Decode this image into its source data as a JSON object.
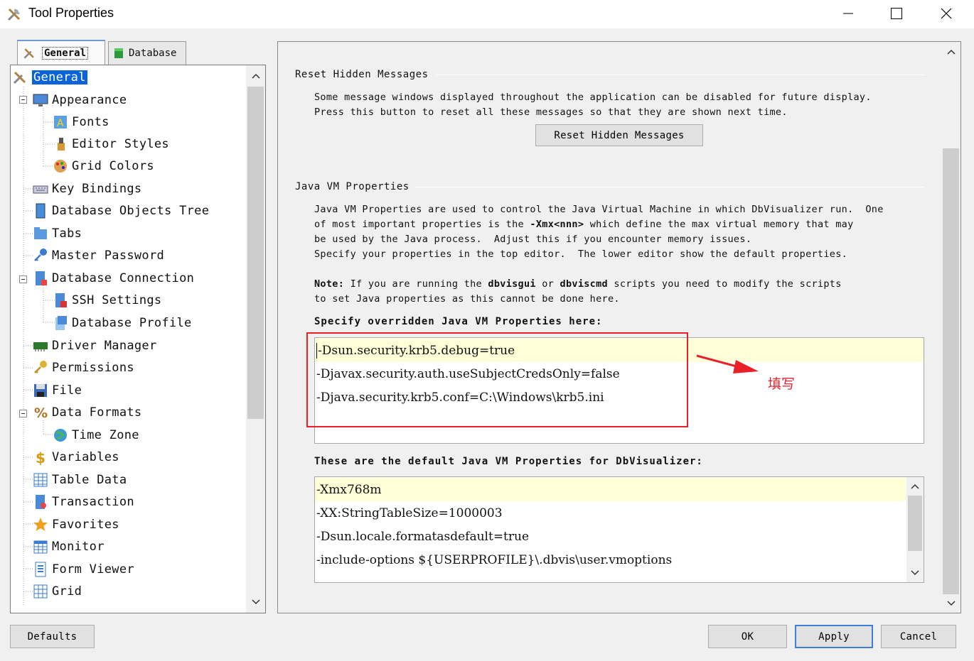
{
  "window": {
    "title": "Tool Properties",
    "app_icon": "tools-icon",
    "controls": [
      "minimize",
      "maximize",
      "close"
    ]
  },
  "tabs": [
    {
      "label": "General",
      "icon": "tools-icon",
      "active": true
    },
    {
      "label": "Database",
      "icon": "database-icon",
      "active": false
    }
  ],
  "tree": {
    "items": [
      {
        "label": "General",
        "icon": "tools-icon",
        "level": 0,
        "selected": true
      },
      {
        "label": "Appearance",
        "icon": "monitor-icon",
        "level": 1,
        "expanded": true
      },
      {
        "label": "Fonts",
        "icon": "font-icon",
        "level": 2
      },
      {
        "label": "Editor Styles",
        "icon": "brush-icon",
        "level": 2
      },
      {
        "label": "Grid Colors",
        "icon": "palette-icon",
        "level": 2
      },
      {
        "label": "Key Bindings",
        "icon": "keyboard-icon",
        "level": 1
      },
      {
        "label": "Database Objects Tree",
        "icon": "tree-panel-icon",
        "level": 1
      },
      {
        "label": "Tabs",
        "icon": "tabs-icon",
        "level": 1
      },
      {
        "label": "Master Password",
        "icon": "key-icon",
        "level": 1
      },
      {
        "label": "Database Connection",
        "icon": "db-connection-icon",
        "level": 1,
        "expanded": true
      },
      {
        "label": "SSH Settings",
        "icon": "ssh-icon",
        "level": 2
      },
      {
        "label": "Database Profile",
        "icon": "profile-icon",
        "level": 2
      },
      {
        "label": "Driver Manager",
        "icon": "driver-icon",
        "level": 1
      },
      {
        "label": "Permissions",
        "icon": "permission-key-icon",
        "level": 1
      },
      {
        "label": "File",
        "icon": "floppy-icon",
        "level": 1
      },
      {
        "label": "Data Formats",
        "icon": "percent-icon",
        "level": 1,
        "expanded": true
      },
      {
        "label": "Time Zone",
        "icon": "globe-icon",
        "level": 2
      },
      {
        "label": "Variables",
        "icon": "dollar-icon",
        "level": 1
      },
      {
        "label": "Table Data",
        "icon": "table-icon",
        "level": 1
      },
      {
        "label": "Transaction",
        "icon": "transaction-icon",
        "level": 1
      },
      {
        "label": "Favorites",
        "icon": "star-icon",
        "level": 1
      },
      {
        "label": "Monitor",
        "icon": "calendar-icon",
        "level": 1
      },
      {
        "label": "Form Viewer",
        "icon": "form-icon",
        "level": 1
      },
      {
        "label": "Grid",
        "icon": "grid-icon",
        "level": 1
      }
    ]
  },
  "reset_section": {
    "title": "Reset Hidden Messages",
    "text_line1": "Some message windows displayed throughout the application can be disabled for future display.",
    "text_line2": "Press this button to reset all these messages so that they are shown next time.",
    "button_label": "Reset Hidden Messages"
  },
  "jvm_section": {
    "title": "Java VM Properties",
    "desc_line1": "Java VM Properties are used to control the Java Virtual Machine in which DbVisualizer run.  One",
    "desc_line2_a": "of most important properties is the ",
    "desc_line2_bold": "-Xmx<nnn>",
    "desc_line2_b": " which define the max virtual memory that may",
    "desc_line3": "be used by the Java process.  Adjust this if you encounter memory issues.",
    "desc_line4": "Specify your properties in the top editor.  The lower editor show the default properties.",
    "note_label": "Note:",
    "note_a": " If you are running the ",
    "note_b1": "dbvisgui",
    "note_c": " or ",
    "note_b2": "dbviscmd",
    "note_d": " scripts you need to modify the scripts",
    "note_line2": "to set Java properties as this cannot be done here.",
    "override_label": "Specify overridden Java VM Properties here:",
    "override_lines": [
      "-Dsun.security.krb5.debug=true",
      "-Djavax.security.auth.useSubjectCredsOnly=false",
      "-Djava.security.krb5.conf=C:\\Windows\\krb5.ini"
    ],
    "default_label": "These are the default Java VM Properties for DbVisualizer:",
    "default_lines": [
      "-Xmx768m",
      "-XX:StringTableSize=1000003",
      "-Dsun.locale.formatasdefault=true",
      "-include-options ${USERPROFILE}\\.dbvis\\user.vmoptions"
    ]
  },
  "annotation": {
    "text": "填写",
    "color": "#e8202a"
  },
  "footer": {
    "defaults_label": "Defaults",
    "ok_label": "OK",
    "apply_label": "Apply",
    "cancel_label": "Cancel"
  },
  "colors": {
    "selection": "#0a64d8",
    "editor_highlight": "#ffffd8",
    "default_button_border": "#3c7fd6"
  }
}
